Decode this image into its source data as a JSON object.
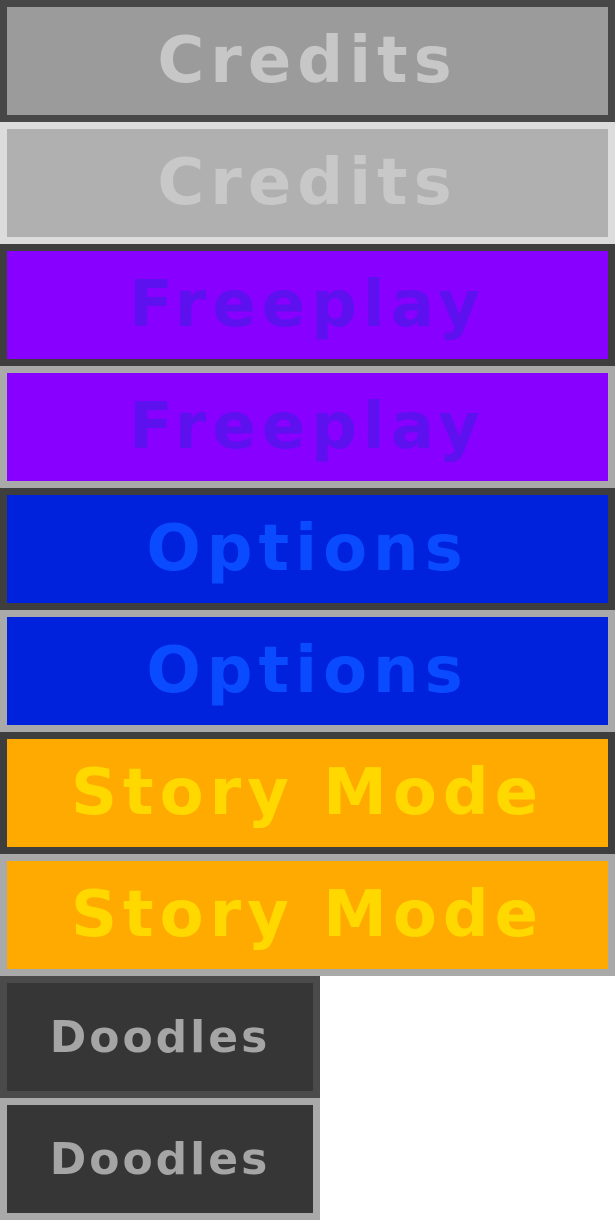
{
  "buttons": {
    "credits_normal": {
      "label": "Credits"
    },
    "credits_hover": {
      "label": "Credits"
    },
    "freeplay_normal": {
      "label": "Freeplay"
    },
    "freeplay_hover": {
      "label": "Freeplay"
    },
    "options_normal": {
      "label": "Options"
    },
    "options_hover": {
      "label": "Options"
    },
    "story_normal": {
      "label": "Story Mode"
    },
    "story_hover": {
      "label": "Story Mode"
    },
    "doodles_normal": {
      "label": "Doodles"
    },
    "doodles_hover": {
      "label": "Doodles"
    }
  },
  "colors": {
    "credits_fill": "#9b9b9b",
    "credits_hover_fill": "#b0b0b0",
    "freeplay_fill": "#8800ff",
    "options_fill": "#0022dd",
    "story_fill": "#ffaa00",
    "doodles_fill": "#363636",
    "normal_border": "#3e3e3e",
    "hover_border": "#a9a9a9"
  }
}
